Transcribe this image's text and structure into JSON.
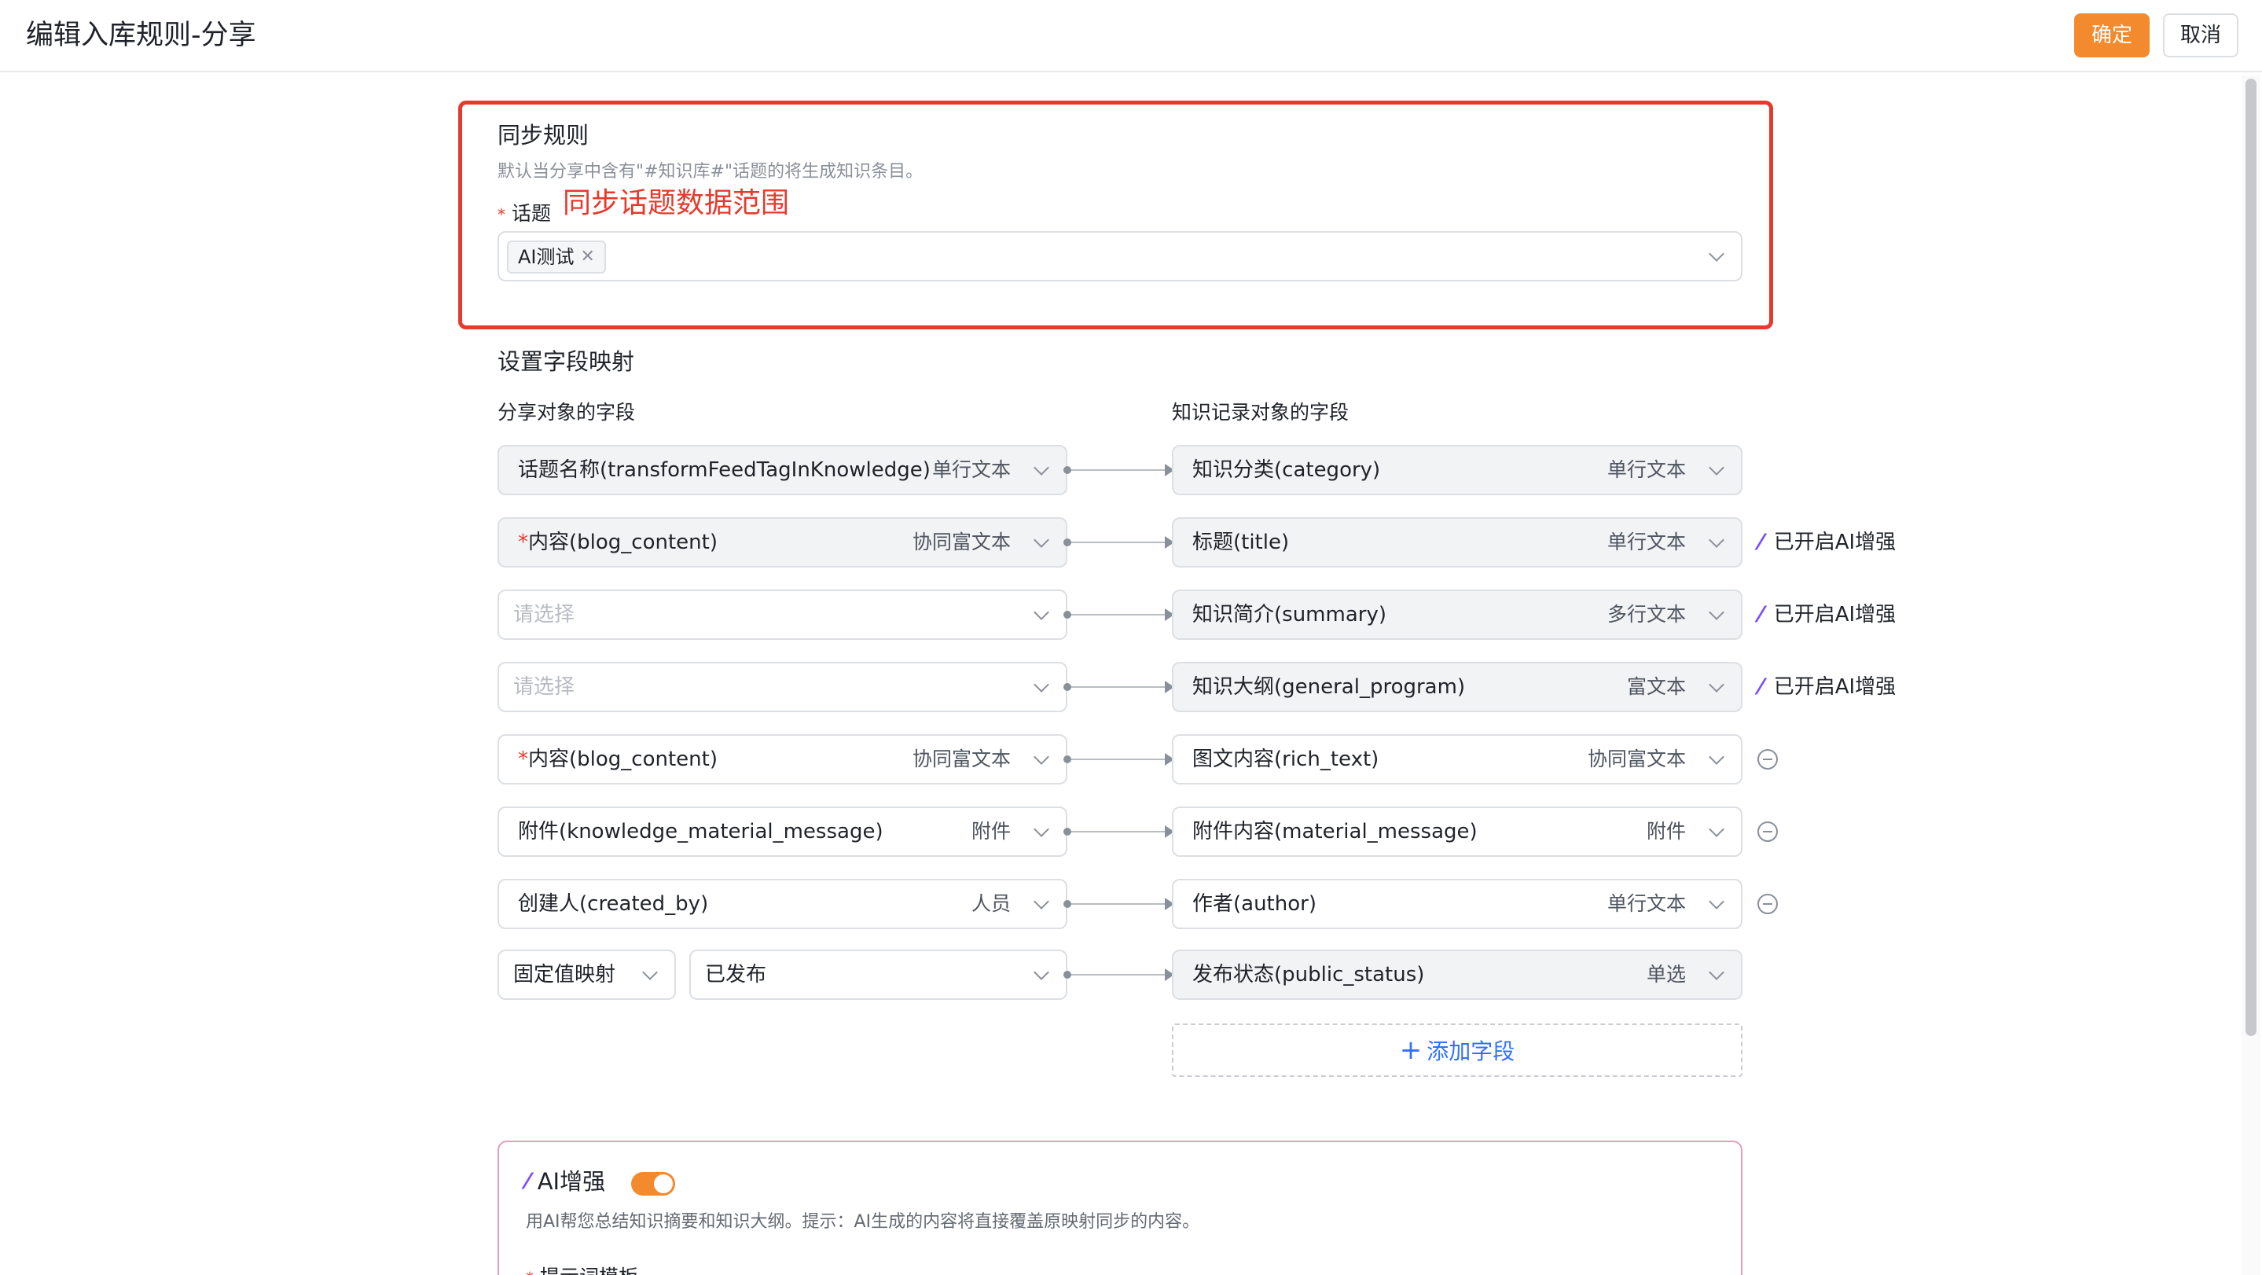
{
  "header": {
    "title": "编辑入库规则-分享",
    "ok_label": "确定",
    "cancel_label": "取消"
  },
  "sync": {
    "title": "同步规则",
    "description": "默认当分享中含有\"#知识库#\"话题的将生成知识条目。",
    "topic_required_mark": "*",
    "topic_label": "话题",
    "annotation": "同步话题数据范围",
    "selected_tags": [
      "AI测试"
    ]
  },
  "mapping": {
    "title": "设置字段映射",
    "source_header": "分享对象的字段",
    "target_header": "知识记录对象的字段",
    "placeholder": "请选择",
    "rows": [
      {
        "source_required": "",
        "source_name": "话题名称(transformFeedTagInKnowledge)",
        "source_type": "单行文本",
        "target_name": "知识分类(category)",
        "target_type": "单行文本",
        "ai_note": "",
        "removable": false
      },
      {
        "source_required": "*",
        "source_name": "内容(blog_content)",
        "source_type": "协同富文本",
        "target_name": "标题(title)",
        "target_type": "单行文本",
        "ai_note": "已开启AI增强",
        "removable": false
      },
      {
        "source_required": "",
        "source_name": "",
        "source_type": "",
        "target_name": "知识简介(summary)",
        "target_type": "多行文本",
        "ai_note": "已开启AI增强",
        "removable": false
      },
      {
        "source_required": "",
        "source_name": "",
        "source_type": "",
        "target_name": "知识大纲(general_program)",
        "target_type": "富文本",
        "ai_note": "已开启AI增强",
        "removable": false
      },
      {
        "source_required": "*",
        "source_name": "内容(blog_content)",
        "source_type": "协同富文本",
        "target_name": "图文内容(rich_text)",
        "target_type": "协同富文本",
        "ai_note": "",
        "removable": true
      },
      {
        "source_required": "",
        "source_name": "附件(knowledge_material_message)",
        "source_type": "附件",
        "target_name": "附件内容(material_message)",
        "target_type": "附件",
        "ai_note": "",
        "removable": true
      },
      {
        "source_required": "",
        "source_name": "创建人(created_by)",
        "source_type": "人员",
        "target_name": "作者(author)",
        "target_type": "单行文本",
        "ai_note": "",
        "removable": true
      }
    ],
    "fixed_row": {
      "mode": "固定值映射",
      "value": "已发布",
      "target_name": "发布状态(public_status)",
      "target_type": "单选"
    },
    "add_field_label": "添加字段"
  },
  "ai": {
    "title": "AI增强",
    "enabled": true,
    "description": "用AI帮您总结知识摘要和知识大纲。提示：AI生成的内容将直接覆盖原映射同步的内容。",
    "prompt_label": "提示词模板"
  },
  "colors": {
    "accent": "#f38a2e",
    "annotation_red": "#e53a2d",
    "link_blue": "#3370ff",
    "ai_purple": "#7b4dff"
  }
}
